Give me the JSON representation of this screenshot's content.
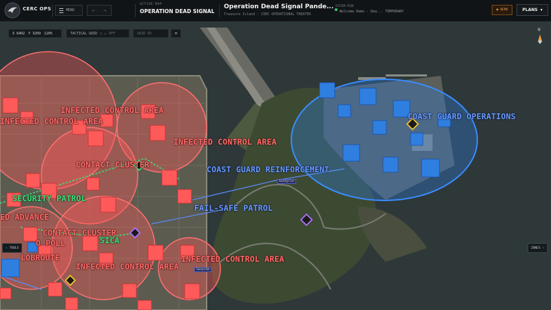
{
  "app": {
    "org_name": "CERC OPS"
  },
  "toolbar": {
    "menu_label": "MENU",
    "undo_icon": "↶",
    "redo_icon": "↷",
    "active_map_label": "ACTIVE MAP",
    "active_map_value": "OPERATION DEAD SIGNAL",
    "operation_title": "Operation Dead Signal Pande...",
    "operation_subtitle": "Treasure Island · CERC OPERATIONAL THEATER",
    "system_label": "SYSTEM FEED",
    "system_message": "Welcome Demo - Dea... TEMPORARY",
    "demo_label": "DEMO",
    "plans_label": "PLANS"
  },
  "map_controls": {
    "x": "X 6402",
    "y": "Y 3209",
    "zoom": "120%",
    "grid_label": "TACTICAL GRID",
    "grid_state": "OFF",
    "grid_toggle_icon": "○ ▭",
    "grid_input_placeholder": "GRID ID",
    "link_icon": "∞",
    "compass_label": "N",
    "tools_label": "TOOLS",
    "zones_label": "ZONES"
  },
  "zones": {
    "red": [
      "INFECTED CONTROL AREA",
      "INFECTED CONTROL AREA",
      "INFECTED CONTROL AREA",
      "INFECTED CONTROL AREA",
      "INFECTED CONTROL AREA",
      "CONTACT CLUSTER",
      "CONTACT CLUSTER",
      "ED ADVANCE",
      "O POLL",
      "LOBROUTE"
    ],
    "blue": [
      "COAST GUARD OPERATIONS",
      "COAST GUARD REINFORCEMENT",
      "FAIL-SAFE PATROL"
    ],
    "green": [
      "SECURITY PATROL",
      "SICA"
    ]
  },
  "units": [
    "Valkyrie",
    "Sunycom"
  ],
  "colors": {
    "infected": "#ff5a5a",
    "coast_guard": "#2f7fe0",
    "patrol": "#3ee07a",
    "accent": "#e8a050"
  }
}
